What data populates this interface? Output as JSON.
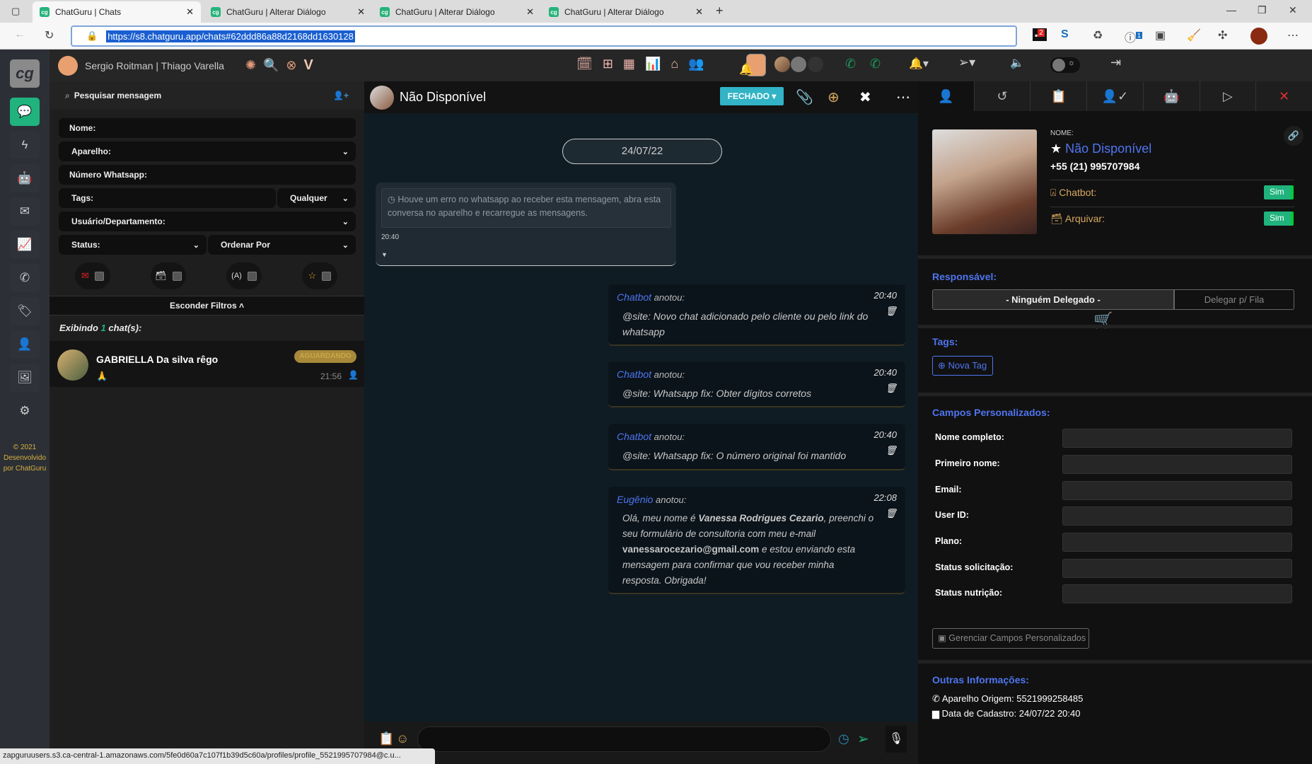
{
  "browser": {
    "tabs": [
      {
        "label": "ChatGuru | Chats"
      },
      {
        "label": "ChatGuru | Alterar Diálogo"
      },
      {
        "label": "ChatGuru | Alterar Diálogo"
      },
      {
        "label": "ChatGuru | Alterar Diálogo"
      }
    ],
    "url": "https://s8.chatguru.app/chats#62ddd86a88d2168dd1630128",
    "badges": {
      "ext1": "2",
      "ext2": "1"
    },
    "status_url": "zapguruusers.s3.ca-central-1.amazonaws.com/5fe0d60a7c107f1b39d5c60a/profiles/profile_5521995707984@c.u..."
  },
  "app": {
    "logo": "cg",
    "user": "Sergio Roitman | Thiago Varella",
    "copyright": "© 2021 Desenvolvido por ChatGuru"
  },
  "filters": {
    "search": "Pesquisar mensagem",
    "nome": "Nome:",
    "aparelho": "Aparelho:",
    "numero": "Número Whatsapp:",
    "tags": "Tags:",
    "tags_mode": "Qualquer",
    "usuario": "Usuário/Departamento:",
    "status": "Status:",
    "ordenar": "Ordenar Por",
    "hide": "Esconder Filtros ˄",
    "showing_pre": "Exibindo ",
    "showing_count": "1",
    "showing_post": " chat(s):"
  },
  "chat_list": [
    {
      "name": "GABRIELLA Da silva rêgo",
      "preview": "🙏",
      "badge": "AGUARDANDO",
      "time": "21:56"
    }
  ],
  "chat": {
    "name": "Não Disponível",
    "status": "FECHADO",
    "date": "24/07/22",
    "error": {
      "text": "Houve um erro no whatsapp ao receber esta mensagem, abra esta conversa no aparelho e recarregue as mensagens.",
      "time": "20:40"
    },
    "notes": [
      {
        "who": "Chatbot",
        "action": "anotou:",
        "time": "20:40",
        "body": "@site: Novo chat adicionado pelo cliente ou pelo link do whatsapp"
      },
      {
        "who": "Chatbot",
        "action": "anotou:",
        "time": "20:40",
        "body": "@site: Whatsapp fix: Obter dígitos corretos"
      },
      {
        "who": "Chatbot",
        "action": "anotou:",
        "time": "20:40",
        "body": "@site: Whatsapp fix: O número original foi mantido"
      },
      {
        "who": "Eugênio",
        "action": "anotou:",
        "time": "22:08",
        "body_a": "Olá, meu nome é ",
        "bold1": "Vanessa Rodrigues Cezario",
        "body_b": ", preenchi o seu formulário de consultoria com meu e-mail ",
        "bold2": "vanessarocezario@gmail.com",
        "body_c": " e estou enviando esta mensagem para confirmar que vou receber minha resposta. Obrigada!"
      }
    ]
  },
  "contact": {
    "name_label": "NOME:",
    "name": "Não Disponível",
    "phone": "+55 (21) 995707984",
    "chatbot_label": "Chatbot:",
    "chatbot": "Sim",
    "archive_label": "Arquivar:",
    "archive": "Sim",
    "responsavel_title": "Responsável:",
    "responsavel": "- Ninguém Delegado -",
    "delegar": "Delegar p/ Fila",
    "tags_title": "Tags:",
    "nova_tag": "Nova Tag",
    "campos_title": "Campos Personalizados:",
    "campos": [
      {
        "label": "Nome completo:",
        "value": ""
      },
      {
        "label": "Primeiro nome:",
        "value": ""
      },
      {
        "label": "Email:",
        "value": ""
      },
      {
        "label": "User ID:",
        "value": ""
      },
      {
        "label": "Plano:",
        "value": ""
      },
      {
        "label": "Status solicitação:",
        "value": ""
      },
      {
        "label": "Status nutrição:",
        "value": ""
      }
    ],
    "gerenciar": "Gerenciar Campos Personalizados",
    "outras_title": "Outras Informações:",
    "aparelho": "Aparelho Origem: 5521999258485",
    "cadastro": "Data de Cadastro: 24/07/22 20:40"
  },
  "colors": {
    "accent": "#4f75f0",
    "green": "#20b37e",
    "fechado": "#32b3c6",
    "badge": "#a8893a"
  }
}
